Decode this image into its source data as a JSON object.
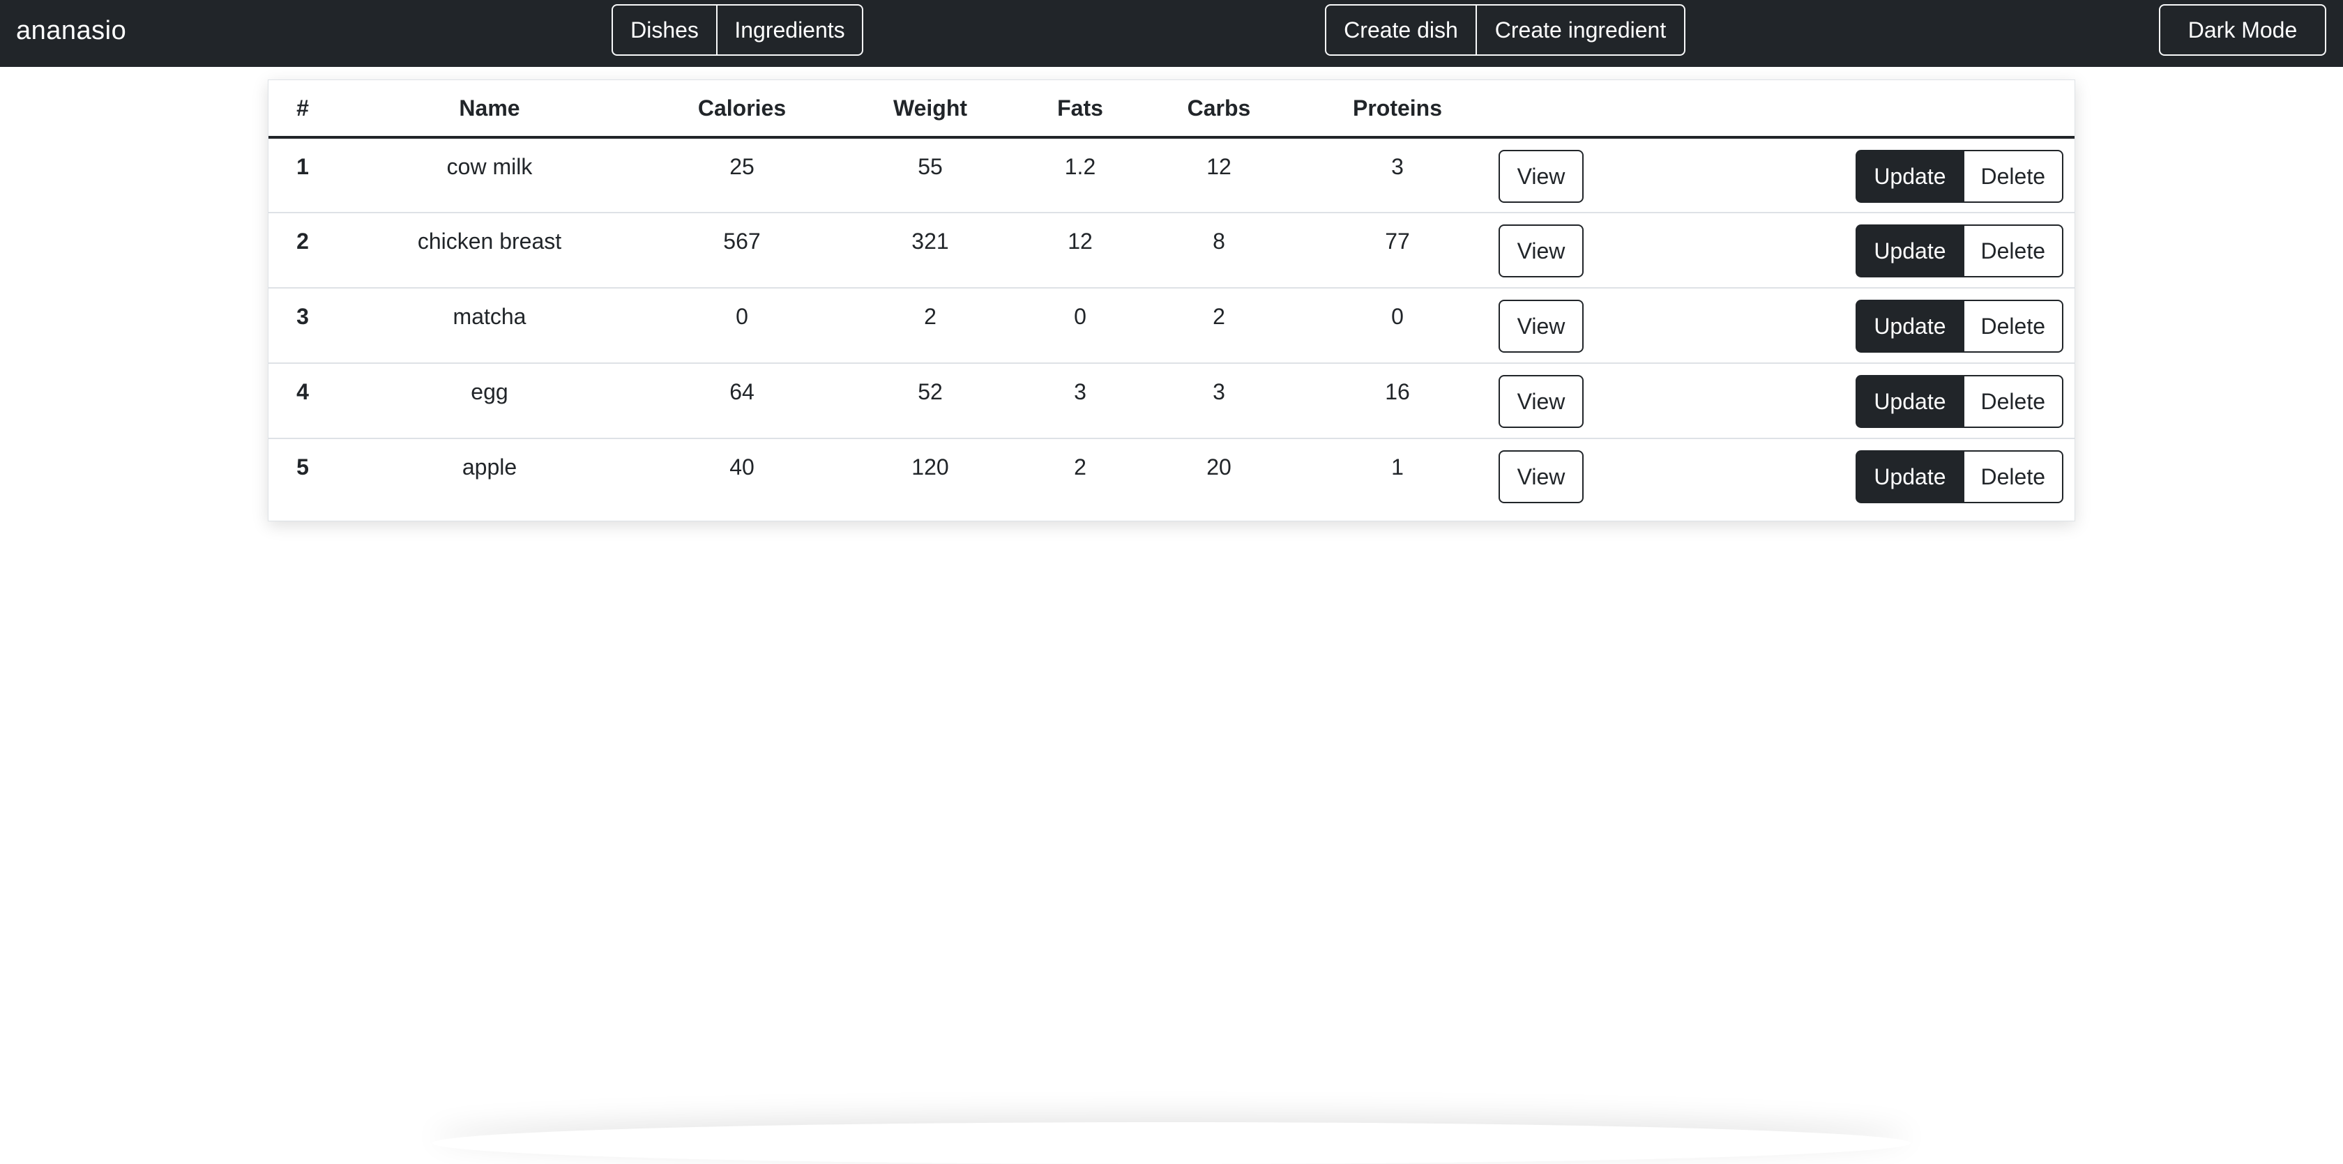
{
  "navbar": {
    "brand": "ananasio",
    "nav_group": [
      "Dishes",
      "Ingredients"
    ],
    "create_group": [
      "Create dish",
      "Create ingredient"
    ],
    "dark_mode_label": "Dark Mode"
  },
  "table": {
    "headers": [
      "#",
      "Name",
      "Calories",
      "Weight",
      "Fats",
      "Carbs",
      "Proteins"
    ],
    "view_label": "View",
    "update_label": "Update",
    "delete_label": "Delete",
    "rows": [
      {
        "idx": "1",
        "name": "cow milk",
        "calories": "25",
        "weight": "55",
        "fats": "1.2",
        "carbs": "12",
        "proteins": "3"
      },
      {
        "idx": "2",
        "name": "chicken breast",
        "calories": "567",
        "weight": "321",
        "fats": "12",
        "carbs": "8",
        "proteins": "77"
      },
      {
        "idx": "3",
        "name": "matcha",
        "calories": "0",
        "weight": "2",
        "fats": "0",
        "carbs": "2",
        "proteins": "0"
      },
      {
        "idx": "4",
        "name": "egg",
        "calories": "64",
        "weight": "52",
        "fats": "3",
        "carbs": "3",
        "proteins": "16"
      },
      {
        "idx": "5",
        "name": "apple",
        "calories": "40",
        "weight": "120",
        "fats": "2",
        "carbs": "20",
        "proteins": "1"
      }
    ]
  },
  "colors": {
    "navbar_bg": "#212529",
    "button_dark": "#212529",
    "row_divider": "#dee2e6"
  }
}
